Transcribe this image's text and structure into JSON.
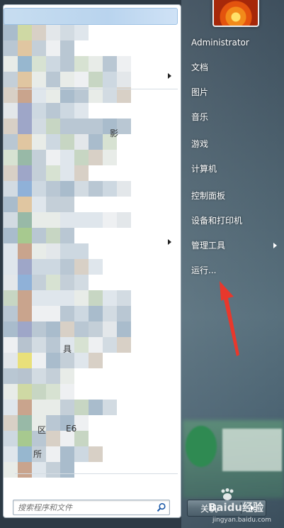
{
  "user": {
    "name": "Administrator"
  },
  "right_menu": [
    {
      "label": "Administrator",
      "key": "user"
    },
    {
      "label": "文档",
      "key": "documents"
    },
    {
      "label": "图片",
      "key": "pictures"
    },
    {
      "label": "音乐",
      "key": "music"
    },
    {
      "label": "游戏",
      "key": "games"
    },
    {
      "label": "计算机",
      "key": "computer"
    },
    {
      "label": "控制面板",
      "key": "control-panel"
    },
    {
      "label": "设备和打印机",
      "key": "devices-printers"
    },
    {
      "label": "管理工具",
      "key": "admin-tools",
      "has_submenu": true
    },
    {
      "label": "运行...",
      "key": "run"
    }
  ],
  "left_panel": {
    "visible_fragments": [
      "影",
      "具",
      "区",
      "E6",
      "所"
    ]
  },
  "search": {
    "placeholder": "搜索程序和文件"
  },
  "shutdown": {
    "label": "关机"
  },
  "watermark": {
    "brand": "Baidu经验",
    "url": "jingyan.baidu.com"
  },
  "colors": {
    "annotation_arrow": "#e8382c",
    "menu_text": "#ffffff"
  }
}
